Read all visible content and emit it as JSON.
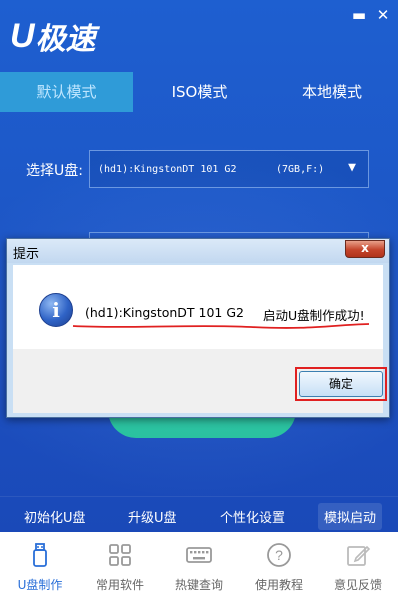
{
  "app": {
    "logo_u": "U",
    "logo_text": "极速",
    "minimize_glyph": "▬",
    "close_glyph": "✕"
  },
  "tabs": [
    {
      "label": "默认模式",
      "active": true
    },
    {
      "label": "ISO模式",
      "active": false
    },
    {
      "label": "本地模式",
      "active": false
    }
  ],
  "select_device": {
    "label": "选择U盘:",
    "device": "(hd1):KingstonDT 101 G2",
    "capacity": "(7GB,F:)",
    "arrow_icon": "caret-down-icon"
  },
  "bottom_links": [
    "初始化U盘",
    "升级U盘",
    "个性化设置",
    "模拟启动"
  ],
  "nav": [
    {
      "label": "U盘制作",
      "icon": "usb-drive-icon",
      "active": true
    },
    {
      "label": "常用软件",
      "icon": "grid-apps-icon",
      "active": false
    },
    {
      "label": "热键查询",
      "icon": "keyboard-icon",
      "active": false
    },
    {
      "label": "使用教程",
      "icon": "question-icon",
      "active": false
    },
    {
      "label": "意见反馈",
      "icon": "edit-icon",
      "active": false
    }
  ],
  "dialog": {
    "title": "提示",
    "close_glyph": "x",
    "info_glyph": "i",
    "message_device": "(hd1):KingstonDT 101 G2",
    "message_result": "启动U盘制作成功!",
    "ok_label": "确定"
  },
  "colors": {
    "app_bg": "#1d58c8",
    "active_tab": "#2f9bd8",
    "start_button": "#26c49a",
    "highlight_box": "#e02020",
    "nav_active": "#2a6fd8"
  }
}
